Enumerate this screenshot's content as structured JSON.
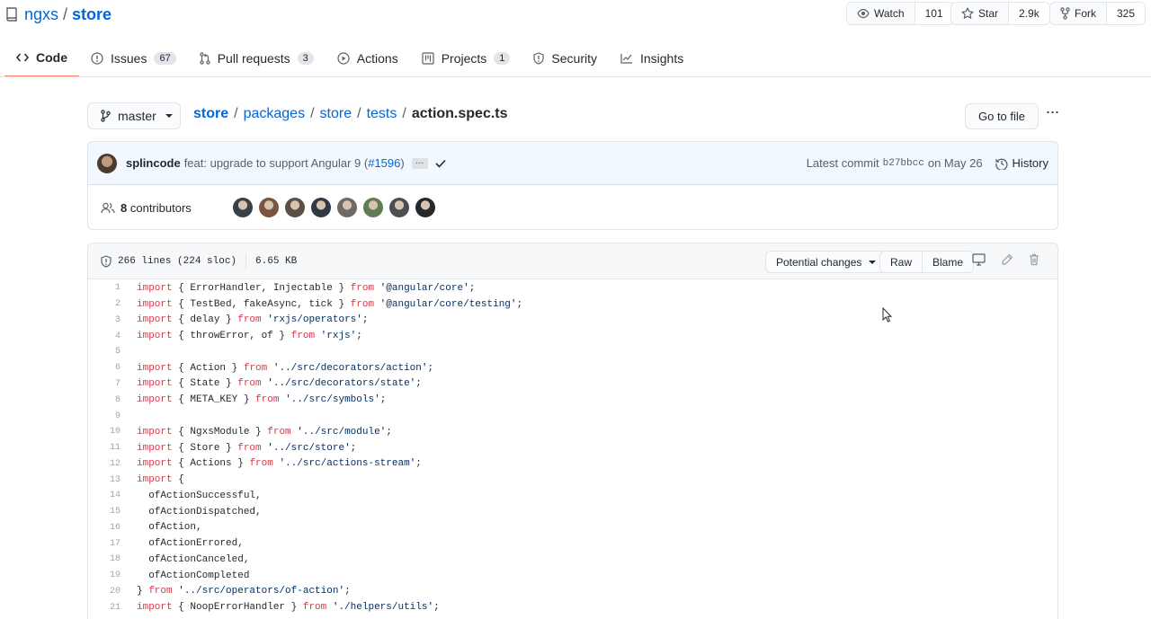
{
  "repo": {
    "owner": "ngxs",
    "sep": "/",
    "name": "store"
  },
  "social": {
    "watch_label": "Watch",
    "watch_count": "101",
    "star_label": "Star",
    "star_count": "2.9k",
    "fork_label": "Fork",
    "fork_count": "325"
  },
  "tabs": [
    {
      "label": "Code",
      "counter": null
    },
    {
      "label": "Issues",
      "counter": "67"
    },
    {
      "label": "Pull requests",
      "counter": "3"
    },
    {
      "label": "Actions",
      "counter": null
    },
    {
      "label": "Projects",
      "counter": "1"
    },
    {
      "label": "Security",
      "counter": null
    },
    {
      "label": "Insights",
      "counter": null
    }
  ],
  "branch": {
    "name": "master"
  },
  "breadcrumb": {
    "items": [
      "store",
      "packages",
      "store",
      "tests"
    ],
    "file": "action.spec.ts",
    "sep": "/"
  },
  "go_to_file": "Go to file",
  "more": "···",
  "commit": {
    "author": "splincode",
    "message": "feat: upgrade to support Angular 9 (",
    "pr": "#1596",
    "message_end": ")",
    "ellipsis": "…",
    "latest_label": "Latest commit",
    "sha": "b27bbcc",
    "date": "on May 26",
    "history_label": "History"
  },
  "contributors": {
    "count": "8",
    "label": "contributors",
    "avatar_colors": [
      "#3b3f46",
      "#7a5640",
      "#5a5048",
      "#2f3a44",
      "#6f6a63",
      "#5f7d54",
      "#4b4e55",
      "#24292e"
    ]
  },
  "file": {
    "lines": "266 lines (224 sloc)",
    "size": "6.65 KB",
    "potential_changes": "Potential changes",
    "raw": "Raw",
    "blame": "Blame"
  },
  "code_lines": [
    {
      "n": "1",
      "t": [
        [
          "kw",
          "import"
        ],
        [
          "",
          "{ ErrorHandler, Injectable } "
        ],
        [
          "kw",
          "from"
        ],
        [
          "",
          " "
        ],
        [
          "str",
          "'@angular/core'"
        ],
        [
          "",
          ";"
        ]
      ]
    },
    {
      "n": "2",
      "t": [
        [
          "kw",
          "import"
        ],
        [
          "",
          "{ TestBed, fakeAsync, tick } "
        ],
        [
          "kw",
          "from"
        ],
        [
          "",
          " "
        ],
        [
          "str",
          "'@angular/core/testing'"
        ],
        [
          "",
          ";"
        ]
      ]
    },
    {
      "n": "3",
      "t": [
        [
          "kw",
          "import"
        ],
        [
          "",
          "{ delay } "
        ],
        [
          "kw",
          "from"
        ],
        [
          "",
          " "
        ],
        [
          "str",
          "'rxjs/operators'"
        ],
        [
          "",
          ";"
        ]
      ]
    },
    {
      "n": "4",
      "t": [
        [
          "kw",
          "import"
        ],
        [
          "",
          "{ throwError, of } "
        ],
        [
          "kw",
          "from"
        ],
        [
          "",
          " "
        ],
        [
          "str",
          "'rxjs'"
        ],
        [
          "",
          ";"
        ]
      ]
    },
    {
      "n": "5",
      "t": []
    },
    {
      "n": "6",
      "t": [
        [
          "kw",
          "import"
        ],
        [
          "",
          "{ Action } "
        ],
        [
          "kw",
          "from"
        ],
        [
          "",
          " "
        ],
        [
          "str",
          "'../src/decorators/action'"
        ],
        [
          "",
          ";"
        ]
      ]
    },
    {
      "n": "7",
      "t": [
        [
          "kw",
          "import"
        ],
        [
          "",
          "{ State } "
        ],
        [
          "kw",
          "from"
        ],
        [
          "",
          " "
        ],
        [
          "str",
          "'../src/decorators/state'"
        ],
        [
          "",
          ";"
        ]
      ]
    },
    {
      "n": "8",
      "t": [
        [
          "kw",
          "import"
        ],
        [
          "",
          "{ META_KEY } "
        ],
        [
          "kw",
          "from"
        ],
        [
          "",
          " "
        ],
        [
          "str",
          "'../src/symbols'"
        ],
        [
          "",
          ";"
        ]
      ]
    },
    {
      "n": "9",
      "t": []
    },
    {
      "n": "10",
      "t": [
        [
          "kw",
          "import"
        ],
        [
          "",
          "{ NgxsModule } "
        ],
        [
          "kw",
          "from"
        ],
        [
          "",
          " "
        ],
        [
          "str",
          "'../src/module'"
        ],
        [
          "",
          ";"
        ]
      ]
    },
    {
      "n": "11",
      "t": [
        [
          "kw",
          "import"
        ],
        [
          "",
          "{ Store } "
        ],
        [
          "kw",
          "from"
        ],
        [
          "",
          " "
        ],
        [
          "str",
          "'../src/store'"
        ],
        [
          "",
          ";"
        ]
      ]
    },
    {
      "n": "12",
      "t": [
        [
          "kw",
          "import"
        ],
        [
          "",
          "{ Actions } "
        ],
        [
          "kw",
          "from"
        ],
        [
          "",
          " "
        ],
        [
          "str",
          "'../src/actions-stream'"
        ],
        [
          "",
          ";"
        ]
      ]
    },
    {
      "n": "13",
      "t": [
        [
          "kw",
          "import"
        ],
        [
          "",
          "{"
        ]
      ]
    },
    {
      "n": "14",
      "t": [
        [
          "",
          "  ofActionSuccessful,"
        ]
      ]
    },
    {
      "n": "15",
      "t": [
        [
          "",
          "  ofActionDispatched,"
        ]
      ]
    },
    {
      "n": "16",
      "t": [
        [
          "",
          "  ofAction,"
        ]
      ]
    },
    {
      "n": "17",
      "t": [
        [
          "",
          "  ofActionErrored,"
        ]
      ]
    },
    {
      "n": "18",
      "t": [
        [
          "",
          "  ofActionCanceled,"
        ]
      ]
    },
    {
      "n": "19",
      "t": [
        [
          "",
          "  ofActionCompleted"
        ]
      ]
    },
    {
      "n": "20",
      "t": [
        [
          "",
          "} "
        ],
        [
          "kw",
          "from"
        ],
        [
          "",
          " "
        ],
        [
          "str",
          "'../src/operators/of-action'"
        ],
        [
          "",
          ";"
        ]
      ]
    },
    {
      "n": "21",
      "t": [
        [
          "kw",
          "import"
        ],
        [
          "",
          "{ NoopErrorHandler } "
        ],
        [
          "kw",
          "from"
        ],
        [
          "",
          " "
        ],
        [
          "str",
          "'./helpers/utils'"
        ],
        [
          "",
          ";"
        ]
      ]
    }
  ]
}
